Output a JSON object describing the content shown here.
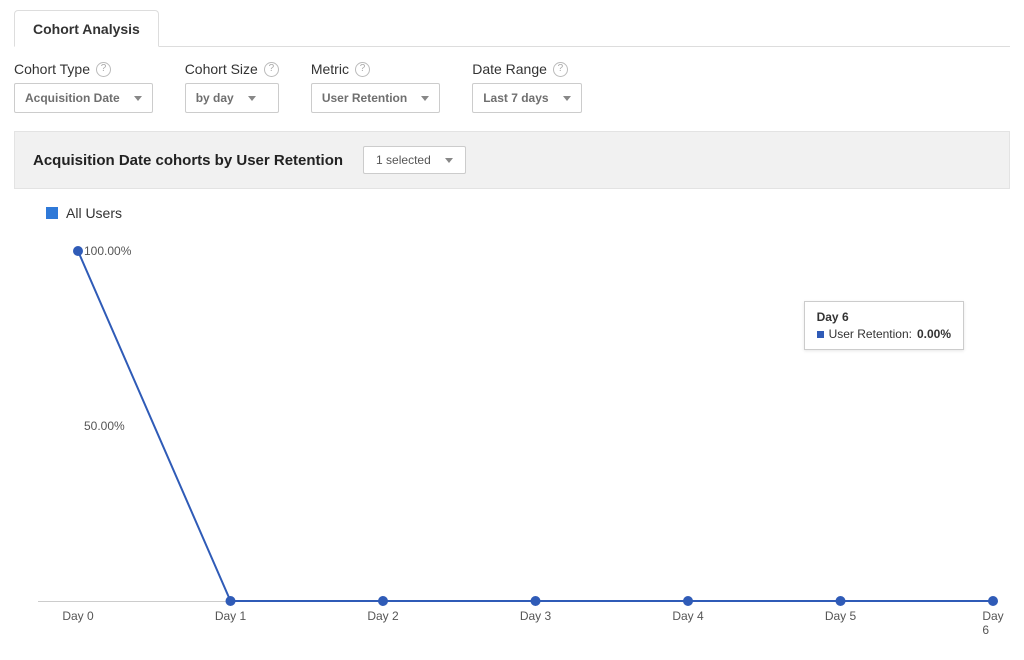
{
  "tab": {
    "label": "Cohort Analysis"
  },
  "filters": {
    "cohort_type": {
      "label": "Cohort Type",
      "value": "Acquisition Date"
    },
    "cohort_size": {
      "label": "Cohort Size",
      "value": "by day"
    },
    "metric": {
      "label": "Metric",
      "value": "User Retention"
    },
    "date_range": {
      "label": "Date Range",
      "value": "Last 7 days"
    }
  },
  "section": {
    "title": "Acquisition Date cohorts by User Retention",
    "selector": "1 selected"
  },
  "legend": {
    "series": "All Users"
  },
  "tooltip": {
    "title": "Day 6",
    "metric": "User Retention:",
    "value": "0.00%"
  },
  "chart_data": {
    "type": "line",
    "categories": [
      "Day 0",
      "Day 1",
      "Day 2",
      "Day 3",
      "Day 4",
      "Day 5",
      "Day 6"
    ],
    "series": [
      {
        "name": "All Users",
        "values": [
          100.0,
          0.0,
          0.0,
          0.0,
          0.0,
          0.0,
          0.0
        ]
      }
    ],
    "ylabel": "",
    "xlabel": "",
    "y_ticks": [
      "100.00%",
      "50.00%"
    ],
    "ylim": [
      0,
      100
    ],
    "title": ""
  },
  "colors": {
    "accent": "#2f5bb7"
  }
}
